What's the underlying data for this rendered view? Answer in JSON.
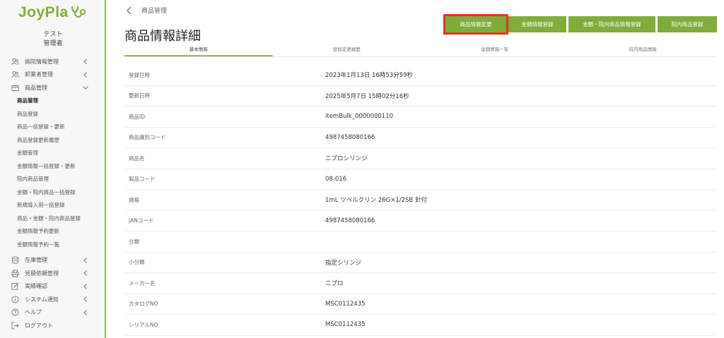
{
  "app": {
    "logo_text": "JoyPla"
  },
  "user": {
    "name": "テスト",
    "role": "管理者"
  },
  "sidebar": {
    "groups": [
      {
        "label": "病院情報管理",
        "icon": "users-icon"
      },
      {
        "label": "卸業者管理",
        "icon": "users-icon"
      },
      {
        "label": "商品管理",
        "icon": "folder-icon"
      }
    ],
    "sub_items": [
      "商品管理",
      "商品登録",
      "商品一括登録・更新",
      "商品登録更新履歴",
      "金額管理",
      "金額情報一括登録・更新",
      "院内商品管理",
      "金額・院内商品一括登録",
      "新規導入用一括登録",
      "商品・金額・院内商品登録",
      "金額情報予約更新",
      "金額情報予約一覧"
    ],
    "lower_groups": [
      {
        "label": "在庫管理",
        "icon": "database-icon"
      },
      {
        "label": "見積依頼管理",
        "icon": "printer-icon"
      },
      {
        "label": "実績確認",
        "icon": "edit-icon"
      },
      {
        "label": "システム通知",
        "icon": "info-icon"
      },
      {
        "label": "ヘルプ",
        "icon": "help-icon"
      },
      {
        "label": "ログアウト",
        "icon": "logout-icon"
      }
    ]
  },
  "breadcrumb": {
    "label": "商品管理"
  },
  "page": {
    "title": "商品情報詳細"
  },
  "buttons": {
    "edit": "商品情報変更",
    "price_register": "金額情報登録",
    "price_inhouse_register": "金額・院内商品情報登録",
    "inhouse_register": "院内商品登録"
  },
  "tabs": [
    "基本情報",
    "登録変更履歴",
    "金額情報一覧",
    "院内商品情報"
  ],
  "details": [
    {
      "label": "登録日時",
      "value": "2023年1月13日 16時53分59秒"
    },
    {
      "label": "更新日時",
      "value": "2025年5月7日 15時02分16秒"
    },
    {
      "label": "商品ID",
      "value": "itemBulk_0000000110"
    },
    {
      "label": "商品識別コード",
      "value": "4987458080166"
    },
    {
      "label": "商品名",
      "value": "ニプロシリンジ"
    },
    {
      "label": "製品コード",
      "value": "08-016"
    },
    {
      "label": "規格",
      "value": "1mL ツベルクリン 26G×1/2SB 針付"
    },
    {
      "label": "JANコード",
      "value": "4987458080166"
    },
    {
      "label": "分類",
      "value": ""
    },
    {
      "label": "小分類",
      "value": "指定シリンジ"
    },
    {
      "label": "メーカー名",
      "value": "ニプロ"
    },
    {
      "label": "カタログNO",
      "value": "MSC0112435"
    },
    {
      "label": "シリアルNO",
      "value": "MSC0112435"
    }
  ],
  "colors": {
    "brand": "#7fb035",
    "button": "#7fac3a",
    "highlight": "#e8321f"
  }
}
